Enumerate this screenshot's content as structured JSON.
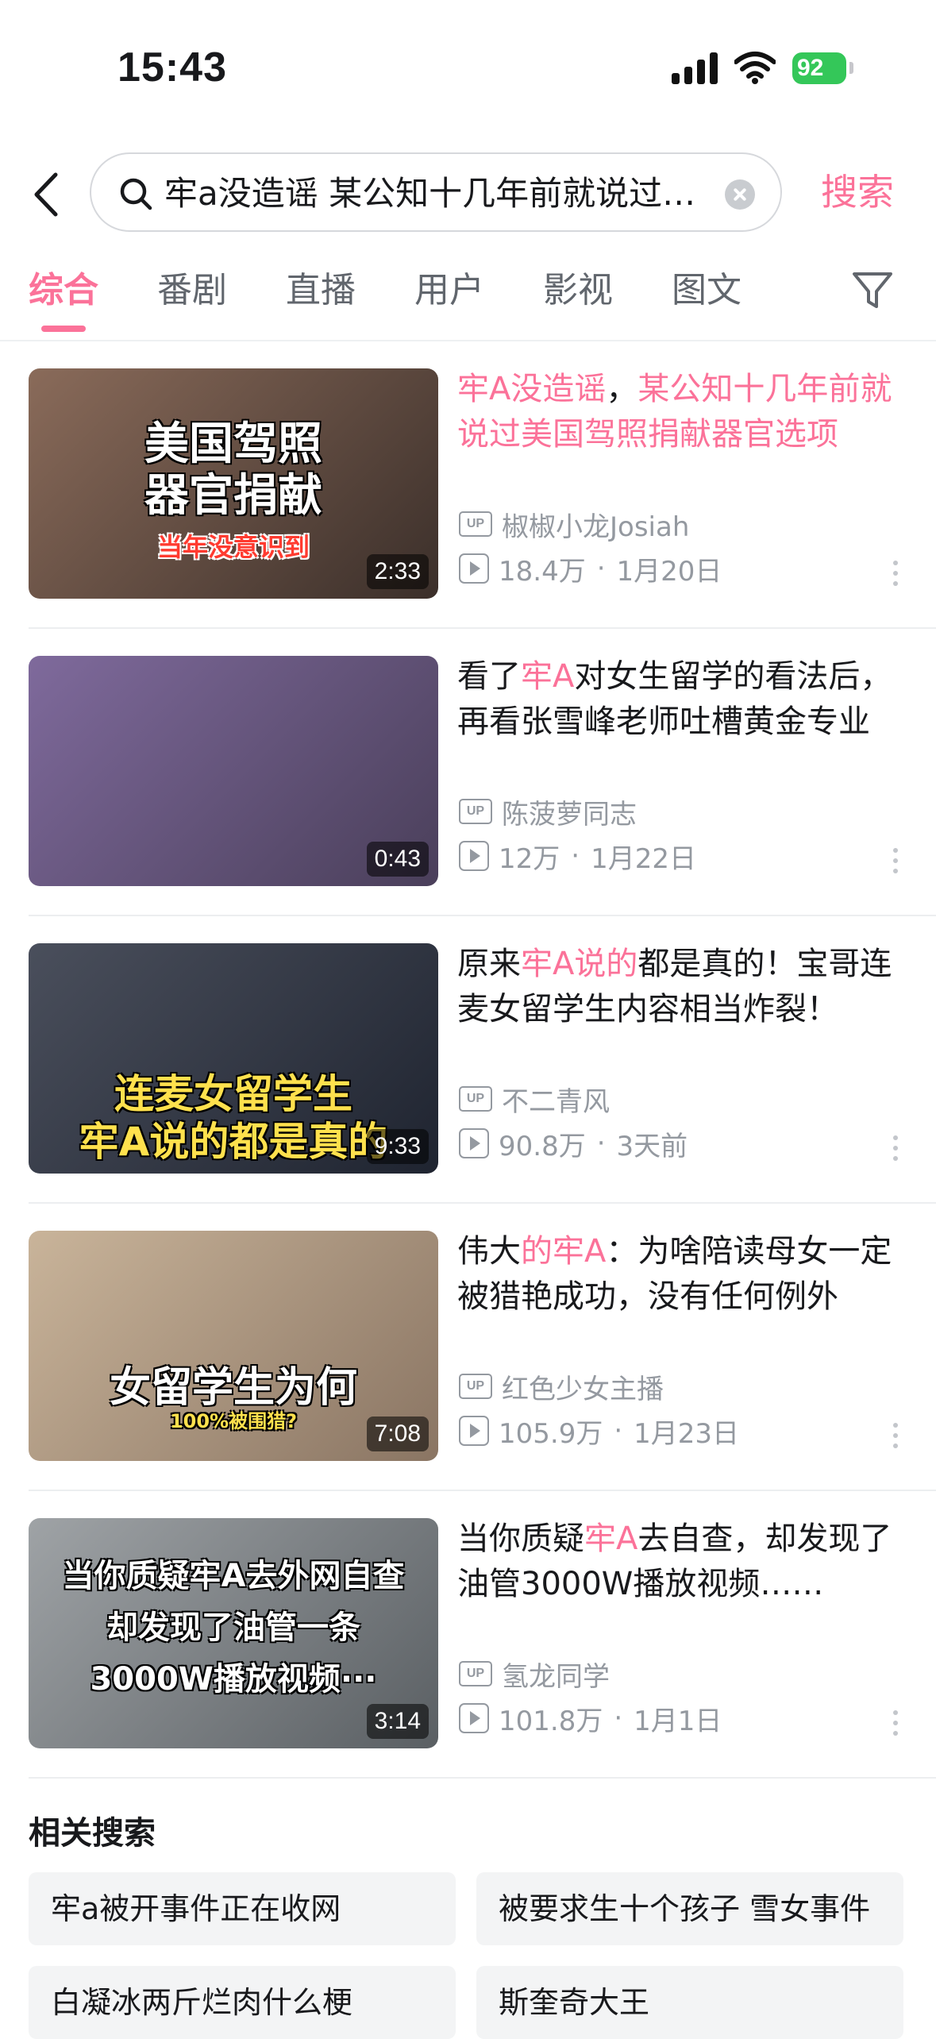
{
  "status": {
    "time": "15:43",
    "battery": "92"
  },
  "search": {
    "query": "牢a没造谣 某公知十几年前就说过美国驾照捐献器官选项",
    "button": "搜索"
  },
  "tabs": [
    {
      "label": "综合"
    },
    {
      "label": "番剧"
    },
    {
      "label": "直播"
    },
    {
      "label": "用户"
    },
    {
      "label": "影视"
    },
    {
      "label": "图文"
    }
  ],
  "results": [
    {
      "title_parts": [
        {
          "text": "牢A没造谣",
          "hl": true
        },
        {
          "text": "，",
          "hl": false
        },
        {
          "text": "某公知十几年前就说过美国驾照捐献器官选项",
          "hl": true
        }
      ],
      "uploader": "椒椒小龙Josiah",
      "views": "18.4万",
      "date": "1月20日",
      "duration": "2:33",
      "thumb_text": [
        "美国驾照",
        "器官捐献",
        "当年没意识到"
      ],
      "thumb_colors": [
        "#8a6b5a",
        "#3b2f2a"
      ]
    },
    {
      "title_parts": [
        {
          "text": "看了",
          "hl": false
        },
        {
          "text": "牢A",
          "hl": true
        },
        {
          "text": "对女生留学的看法后，再看张雪峰老师吐槽黄金专业",
          "hl": false
        }
      ],
      "uploader": "陈菠萝同志",
      "views": "12万",
      "date": "1月22日",
      "duration": "0:43",
      "thumb_text": [],
      "thumb_colors": [
        "#7f6a9c",
        "#4a3f5a"
      ]
    },
    {
      "title_parts": [
        {
          "text": "原来",
          "hl": false
        },
        {
          "text": "牢A说的",
          "hl": true
        },
        {
          "text": "都是真的！宝哥连麦女留学生内容相当炸裂！",
          "hl": false
        }
      ],
      "uploader": "不二青风",
      "views": "90.8万",
      "date": "3天前",
      "duration": "9:33",
      "thumb_text": [
        "连麦女留学生",
        "牢A说的都是真的"
      ],
      "thumb_colors": [
        "#4a4f5c",
        "#1f2430"
      ]
    },
    {
      "title_parts": [
        {
          "text": "伟大",
          "hl": false
        },
        {
          "text": "的牢A",
          "hl": true
        },
        {
          "text": "：为啥陪读母女一定被猎艳成功，没有任何例外",
          "hl": false
        }
      ],
      "uploader": "红色少女主播",
      "views": "105.9万",
      "date": "1月23日",
      "duration": "7:08",
      "thumb_text": [
        "女留学生为何",
        "100%被围猎?"
      ],
      "thumb_colors": [
        "#c9b49a",
        "#8a7563"
      ]
    },
    {
      "title_parts": [
        {
          "text": "当你质疑",
          "hl": false
        },
        {
          "text": "牢A",
          "hl": true
        },
        {
          "text": "去自查，却发现了油管3000W播放视频……",
          "hl": false
        }
      ],
      "uploader": "氢龙同学",
      "views": "101.8万",
      "date": "1月1日",
      "duration": "3:14",
      "thumb_text": [
        "当你质疑牢A去外网自查",
        "却发现了油管一条",
        "3000W播放视频···"
      ],
      "thumb_colors": [
        "#9fa3a6",
        "#5a5f63"
      ]
    }
  ],
  "related": {
    "title": "相关搜索",
    "items": [
      "牢a被开事件正在收网",
      "被要求生十个孩子 雪女事件",
      "白凝冰两斤烂肉什么梗",
      "斯奎奇大王"
    ]
  }
}
